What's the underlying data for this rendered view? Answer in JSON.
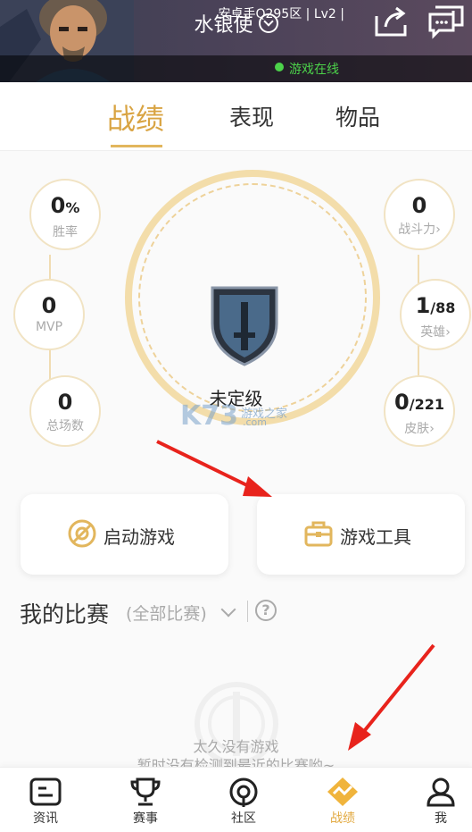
{
  "header": {
    "username": "水银使",
    "account_info": "安卓手Q295区 | Lv2 |",
    "status_text": "游戏在线"
  },
  "tabs": [
    {
      "label": "战绩",
      "active": true
    },
    {
      "label": "表现",
      "active": false
    },
    {
      "label": "物品",
      "active": false
    }
  ],
  "stats_left": [
    {
      "value": "0",
      "unit": "%",
      "label": "胜率"
    },
    {
      "value": "0",
      "unit": "",
      "label": "MVP"
    },
    {
      "value": "0",
      "unit": "",
      "label": "总场数"
    }
  ],
  "stats_right": [
    {
      "value": "0",
      "total": "",
      "label": "战斗力",
      "chevron": "›"
    },
    {
      "value": "1",
      "total": "/88",
      "label": "英雄",
      "chevron": "›"
    },
    {
      "value": "0",
      "total": "/221",
      "label": "皮肤",
      "chevron": "›"
    }
  ],
  "rank": {
    "label": "未定级"
  },
  "watermark": {
    "logo": "K73",
    "site": "游戏之家",
    "domain": ".com"
  },
  "actions": {
    "launch_game": "启动游戏",
    "game_tools": "游戏工具"
  },
  "matches": {
    "title": "我的比赛",
    "filter": "(全部比赛)",
    "help": "?",
    "empty_line1": "太久没有游戏",
    "empty_line2": "暂时没有检测到最近的比赛哟~"
  },
  "nav": [
    {
      "label": "资讯",
      "icon": "news-icon",
      "active": false
    },
    {
      "label": "赛事",
      "icon": "trophy-icon",
      "active": false
    },
    {
      "label": "社区",
      "icon": "community-icon",
      "active": false
    },
    {
      "label": "战绩",
      "icon": "record-icon",
      "active": true
    },
    {
      "label": "我",
      "icon": "profile-icon",
      "active": false
    }
  ],
  "colors": {
    "accent": "#d9a443",
    "online": "#4cd24a",
    "ring": "#f3ddaa",
    "arrow": "#e8231c"
  }
}
